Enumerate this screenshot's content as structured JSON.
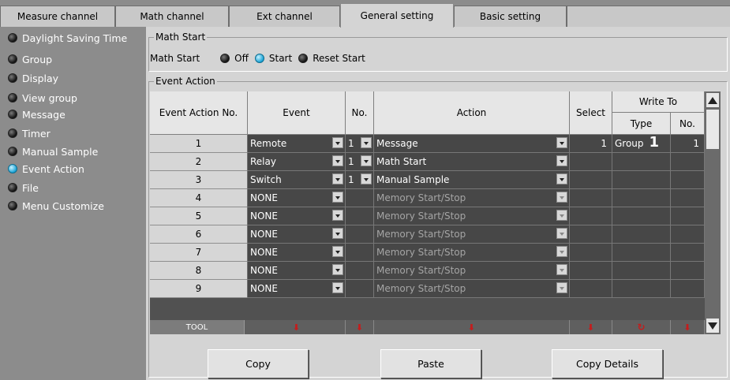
{
  "tabs": [
    {
      "label": "Measure channel",
      "active": false
    },
    {
      "label": "Math channel",
      "active": false
    },
    {
      "label": "Ext channel",
      "active": false
    },
    {
      "label": "General setting",
      "active": true
    },
    {
      "label": "Basic setting",
      "active": false
    }
  ],
  "sidebar": {
    "items": [
      {
        "label": "Daylight Saving Time",
        "selected": false
      },
      {
        "label": "Group",
        "selected": false
      },
      {
        "label": "Display",
        "selected": false
      },
      {
        "label": "View group",
        "selected": false
      },
      {
        "label": "Message",
        "selected": false
      },
      {
        "label": "Timer",
        "selected": false
      },
      {
        "label": "Manual Sample",
        "selected": false
      },
      {
        "label": "Event Action",
        "selected": true
      },
      {
        "label": "File",
        "selected": false
      },
      {
        "label": "Menu Customize",
        "selected": false
      }
    ]
  },
  "math_start": {
    "group_title": "Math Start",
    "row_label": "Math Start",
    "options": [
      {
        "label": "Off",
        "selected": false
      },
      {
        "label": "Start",
        "selected": true
      },
      {
        "label": "Reset Start",
        "selected": false
      }
    ]
  },
  "event_action": {
    "group_title": "Event Action",
    "headers": {
      "no": "Event Action No.",
      "event": "Event",
      "event_no": "No.",
      "action": "Action",
      "select": "Select",
      "write_to": "Write To",
      "type": "Type",
      "write_no": "No."
    },
    "rows": [
      {
        "no": "1",
        "event": "Remote",
        "event_no": "1",
        "action": "Message",
        "select": "1",
        "type": "Group",
        "type_num": "1",
        "write_no": "1",
        "dim": false
      },
      {
        "no": "2",
        "event": "Relay",
        "event_no": "1",
        "action": "Math Start",
        "select": "",
        "type": "",
        "type_num": "",
        "write_no": "",
        "dim": false
      },
      {
        "no": "3",
        "event": "Switch",
        "event_no": "1",
        "action": "Manual Sample",
        "select": "",
        "type": "",
        "type_num": "",
        "write_no": "",
        "dim": false
      },
      {
        "no": "4",
        "event": "NONE",
        "event_no": "",
        "action": "Memory Start/Stop",
        "select": "",
        "type": "",
        "type_num": "",
        "write_no": "",
        "dim": true
      },
      {
        "no": "5",
        "event": "NONE",
        "event_no": "",
        "action": "Memory Start/Stop",
        "select": "",
        "type": "",
        "type_num": "",
        "write_no": "",
        "dim": true
      },
      {
        "no": "6",
        "event": "NONE",
        "event_no": "",
        "action": "Memory Start/Stop",
        "select": "",
        "type": "",
        "type_num": "",
        "write_no": "",
        "dim": true
      },
      {
        "no": "7",
        "event": "NONE",
        "event_no": "",
        "action": "Memory Start/Stop",
        "select": "",
        "type": "",
        "type_num": "",
        "write_no": "",
        "dim": true
      },
      {
        "no": "8",
        "event": "NONE",
        "event_no": "",
        "action": "Memory Start/Stop",
        "select": "",
        "type": "",
        "type_num": "",
        "write_no": "",
        "dim": true
      },
      {
        "no": "9",
        "event": "NONE",
        "event_no": "",
        "action": "Memory Start/Stop",
        "select": "",
        "type": "",
        "type_num": "",
        "write_no": "",
        "dim": true
      }
    ],
    "tool_label": "TOOL",
    "tool_icons": [
      "down-arrow-icon",
      "down-arrow-icon",
      "down-arrow-icon",
      "down-arrow-icon",
      "cycle-icon",
      "down-arrow-icon"
    ]
  },
  "buttons": {
    "copy": "Copy",
    "paste": "Paste",
    "copy_details": "Copy Details"
  },
  "colors": {
    "accent_cyan": "#1aa3d6",
    "tool_arrow": "#c41c1c",
    "grid_bg": "#474747"
  }
}
